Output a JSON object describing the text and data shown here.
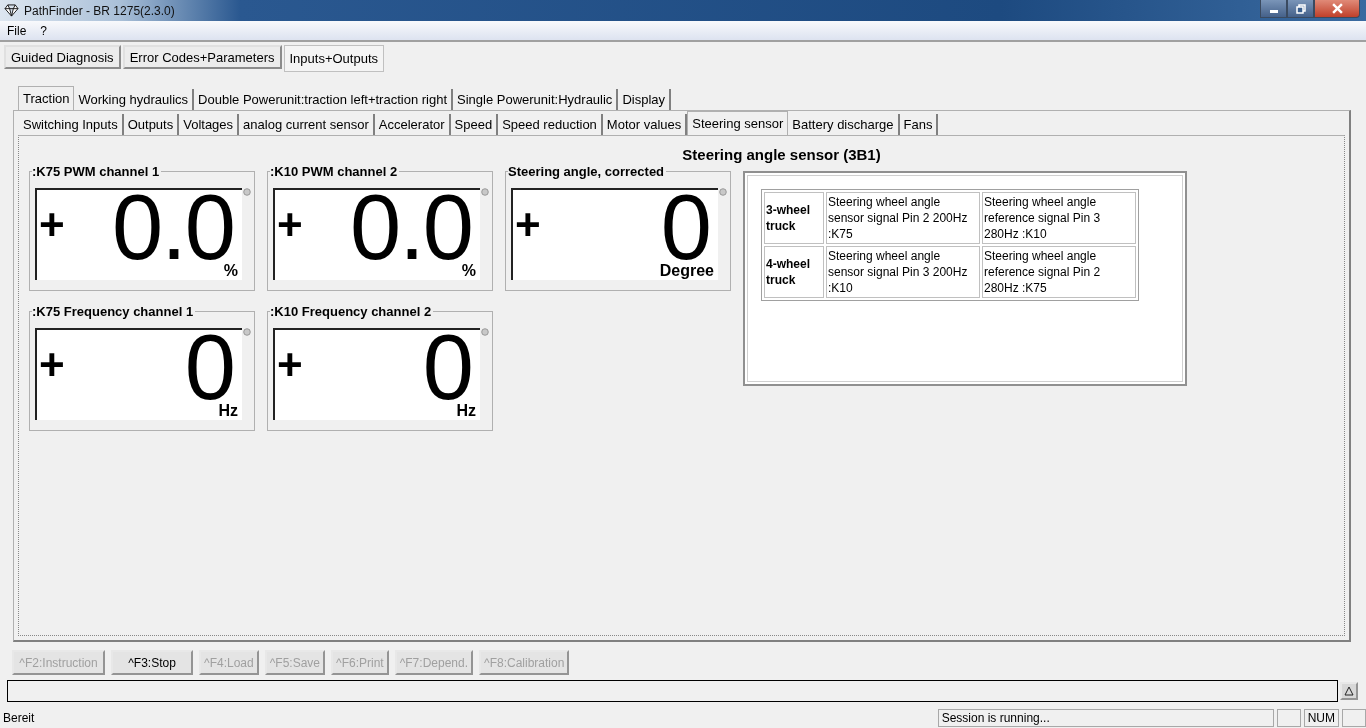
{
  "window": {
    "title": "PathFinder - BR 1275(2.3.0)"
  },
  "menu": [
    "File",
    "?"
  ],
  "main_tabs": [
    {
      "label": "Guided Diagnosis",
      "selected": false
    },
    {
      "label": "Error Codes+Parameters",
      "selected": false
    },
    {
      "label": "Inputs+Outputs",
      "selected": true
    }
  ],
  "group_tabs": [
    {
      "label": "Traction",
      "selected": true
    },
    {
      "label": "Working hydraulics",
      "selected": false
    },
    {
      "label": "Double Powerunit:traction left+traction right",
      "selected": false
    },
    {
      "label": "Single Powerunit:Hydraulic",
      "selected": false
    },
    {
      "label": "Display",
      "selected": false
    }
  ],
  "sub_tabs": [
    {
      "label": "Switching Inputs",
      "selected": false
    },
    {
      "label": "Outputs",
      "selected": false
    },
    {
      "label": "Voltages",
      "selected": false
    },
    {
      "label": "analog current sensor",
      "selected": false
    },
    {
      "label": "Accelerator",
      "selected": false
    },
    {
      "label": "Speed",
      "selected": false
    },
    {
      "label": "Speed reduction",
      "selected": false
    },
    {
      "label": "Motor values",
      "selected": false
    },
    {
      "label": "Steering sensor",
      "selected": true
    },
    {
      "label": "Battery discharge",
      "selected": false
    },
    {
      "label": "Fans",
      "selected": false
    }
  ],
  "heading": "Steering angle sensor  (3B1)",
  "gauges": [
    [
      {
        "label": ":K75 PWM channel 1",
        "sign": "+",
        "value": "0.0",
        "unit": "%"
      },
      {
        "label": ":K10 PWM channel 2",
        "sign": "+",
        "value": "0.0",
        "unit": "%"
      },
      {
        "label": "Steering angle, corrected",
        "sign": "+",
        "value": "0",
        "unit": "Degree"
      }
    ],
    [
      {
        "label": ":K75 Frequency channel 1",
        "sign": "+",
        "value": "0",
        "unit": "Hz"
      },
      {
        "label": ":K10 Frequency channel 2",
        "sign": "+",
        "value": "0",
        "unit": "Hz"
      }
    ]
  ],
  "info_table": {
    "rows": [
      {
        "truck": "3-wheel truck",
        "sensor": "Steering wheel angle sensor signal Pin 2 200Hz :K75",
        "reference": "Steering wheel angle reference signal Pin 3 280Hz :K10"
      },
      {
        "truck": "4-wheel truck",
        "sensor": "Steering wheel angle sensor signal Pin 3 200Hz :K10",
        "reference": "Steering wheel angle reference signal Pin 2 280Hz :K75"
      }
    ]
  },
  "buttons": [
    {
      "label": "^F2:Instruction",
      "disabled": true
    },
    {
      "label": "^F3:Stop",
      "disabled": false
    },
    {
      "label": "^F4:Load",
      "disabled": true
    },
    {
      "label": "^F5:Save",
      "disabled": true
    },
    {
      "label": "^F6:Print",
      "disabled": true
    },
    {
      "label": "^F7:Depend.",
      "disabled": true
    },
    {
      "label": "^F8:Calibration",
      "disabled": true
    }
  ],
  "status_bar": {
    "text": "Bereit",
    "session": "Session is running...",
    "num": "NUM"
  }
}
